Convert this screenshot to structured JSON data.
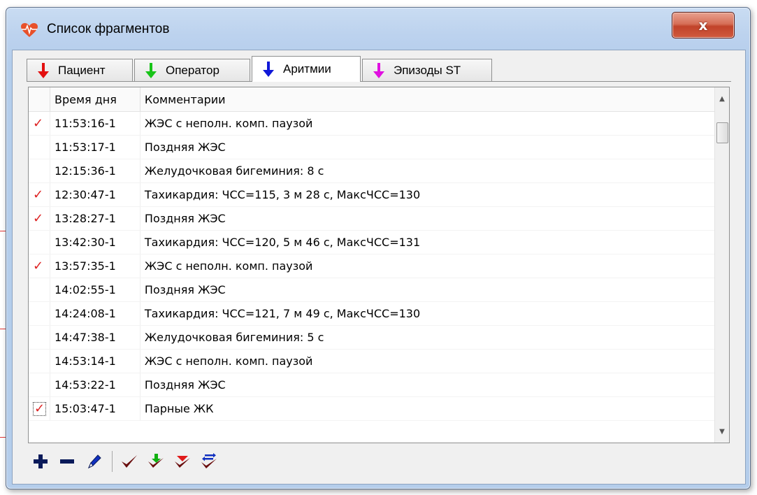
{
  "window": {
    "title": "Список фрагментов",
    "close_label": "x"
  },
  "tabs": [
    {
      "label": "Пациент",
      "arrow_color": "#e31010"
    },
    {
      "label": "Оператор",
      "arrow_color": "#18c418"
    },
    {
      "label": "Аритмии",
      "arrow_color": "#1018d8"
    },
    {
      "label": "Эпизоды ST",
      "arrow_color": "#e010e0"
    }
  ],
  "active_tab": "Аритмии",
  "table": {
    "headers": {
      "check": "",
      "time": "Время дня",
      "comment": "Комментарии"
    },
    "rows": [
      {
        "checked": "✓",
        "time": "11:53:16-1",
        "comment": "ЖЭС с неполн. комп. паузой"
      },
      {
        "checked": "",
        "time": "11:53:17-1",
        "comment": "Поздняя ЖЭС"
      },
      {
        "checked": "",
        "time": "12:15:36-1",
        "comment": "Желудочковая бигеминия: 8 с"
      },
      {
        "checked": "✓",
        "time": "12:30:47-1",
        "comment": "Тахикардия: ЧСС=115,  3 м 28 с, МаксЧСС=130"
      },
      {
        "checked": "✓",
        "time": "13:28:27-1",
        "comment": "Поздняя ЖЭС"
      },
      {
        "checked": "",
        "time": "13:42:30-1",
        "comment": "Тахикардия: ЧСС=120,  5 м 46 с, МаксЧСС=131"
      },
      {
        "checked": "✓",
        "time": "13:57:35-1",
        "comment": "ЖЭС с неполн. комп. паузой"
      },
      {
        "checked": "",
        "time": "14:02:55-1",
        "comment": "Поздняя ЖЭС"
      },
      {
        "checked": "",
        "time": "14:24:08-1",
        "comment": "Тахикардия: ЧСС=121,  7 м 49 с, МаксЧСС=130"
      },
      {
        "checked": "",
        "time": "14:47:38-1",
        "comment": "Желудочковая бигеминия: 5 с"
      },
      {
        "checked": "",
        "time": "14:53:14-1",
        "comment": "ЖЭС с неполн. комп. паузой"
      },
      {
        "checked": "",
        "time": "14:53:22-1",
        "comment": "Поздняя ЖЭС"
      },
      {
        "checked": "✓",
        "time": "15:03:47-1",
        "comment": "Парные ЖК"
      }
    ]
  },
  "toolbar": {
    "buttons": [
      "plus-icon",
      "minus-icon",
      "pen-icon",
      "check-icon",
      "check-add-icon",
      "check-remove-icon",
      "check-swap-icon"
    ]
  },
  "colors": {
    "check_red": "#d22222",
    "toolbar_dark": "#0a1a5a"
  }
}
